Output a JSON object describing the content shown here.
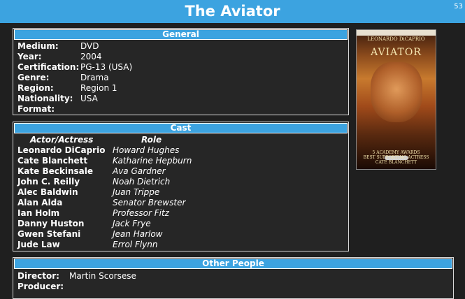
{
  "header": {
    "title": "The Aviator",
    "counter": "53"
  },
  "general": {
    "heading": "General",
    "fields": [
      {
        "label": "Medium:",
        "value": "DVD"
      },
      {
        "label": "Year:",
        "value": "2004"
      },
      {
        "label": "Certification:",
        "value": "PG-13 (USA)"
      },
      {
        "label": "Genre:",
        "value": "Drama"
      },
      {
        "label": "Region:",
        "value": "Region 1"
      },
      {
        "label": "Nationality:",
        "value": "USA"
      },
      {
        "label": "Format:",
        "value": ""
      }
    ]
  },
  "cast": {
    "heading": "Cast",
    "col_actor": "Actor/Actress",
    "col_role": "Role",
    "rows": [
      {
        "actor": "Leonardo DiCaprio",
        "role": "Howard Hughes"
      },
      {
        "actor": "Cate Blanchett",
        "role": "Katharine Hepburn"
      },
      {
        "actor": "Kate Beckinsale",
        "role": "Ava Gardner"
      },
      {
        "actor": "John C. Reilly",
        "role": "Noah Dietrich"
      },
      {
        "actor": "Alec Baldwin",
        "role": "Juan Trippe"
      },
      {
        "actor": "Alan Alda",
        "role": "Senator Brewster"
      },
      {
        "actor": "Ian Holm",
        "role": "Professor Fitz"
      },
      {
        "actor": "Danny Huston",
        "role": "Jack Frye"
      },
      {
        "actor": "Gwen Stefani",
        "role": "Jean Harlow"
      },
      {
        "actor": "Jude Law",
        "role": "Errol Flynn"
      }
    ]
  },
  "other_people": {
    "heading": "Other People",
    "fields": [
      {
        "label": "Director:",
        "value": "Martin Scorsese"
      },
      {
        "label": "Producer:",
        "value": ""
      }
    ]
  },
  "cover": {
    "edition": "2-DISC WIDESCREEN EDITION",
    "star": "LEONARDO DiCAPRIO",
    "title": "AVIATOR",
    "awards_line1": "5 ACADEMY AWARDS",
    "awards_line2": "BEST SUPPORTING ACTRESS",
    "awards_line3": "CATE BLANCHETT"
  }
}
